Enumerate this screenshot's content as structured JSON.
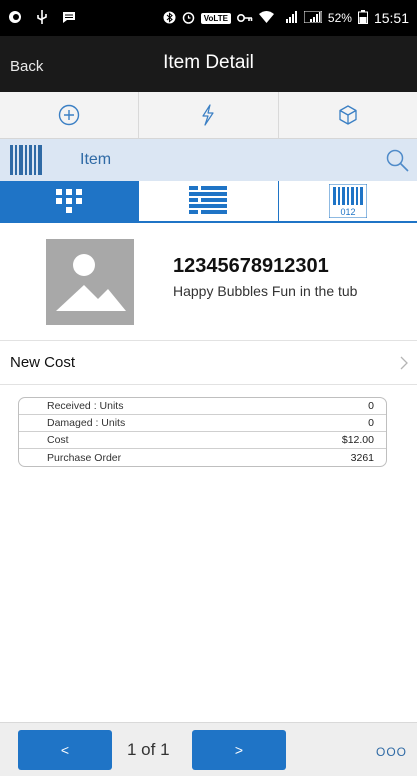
{
  "statusbar": {
    "battery": "52%",
    "time": "15:51",
    "volte": "VoLTE"
  },
  "header": {
    "back_label": "Back",
    "title": "Item Detail"
  },
  "actions": [
    {
      "icon": "add-circle-icon"
    },
    {
      "icon": "lightning-icon"
    },
    {
      "icon": "cube-icon"
    }
  ],
  "search": {
    "label": "Item"
  },
  "tabs": [
    {
      "icon": "grid-view-icon",
      "active": true
    },
    {
      "icon": "list-view-icon",
      "active": false
    },
    {
      "icon": "barcode-view-icon",
      "active": false,
      "badge": "012"
    }
  ],
  "item": {
    "sku": "12345678912301",
    "description": "Happy Bubbles Fun in the tub"
  },
  "new_cost": {
    "label": "New Cost"
  },
  "details": [
    {
      "label": "Received : Units",
      "value": "0"
    },
    {
      "label": "Damaged : Units",
      "value": "0"
    },
    {
      "label": "Cost",
      "value": "$12.00"
    },
    {
      "label": "Purchase Order",
      "value": "3261"
    }
  ],
  "footer": {
    "prev_label": "<",
    "next_label": ">",
    "pager_text": "1 of 1",
    "more_label": "OOO"
  },
  "colors": {
    "accent": "#1f74c6",
    "search_bg": "#dbe6f3",
    "titlebar_bg": "#1a1a1a"
  }
}
